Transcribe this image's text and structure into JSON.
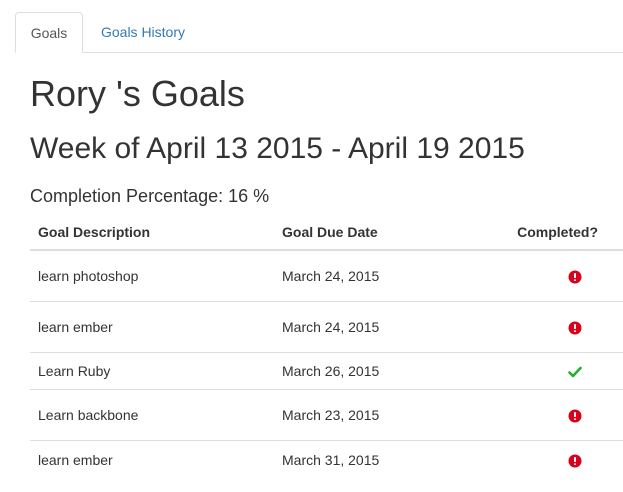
{
  "tabs": [
    {
      "label": "Goals",
      "active": true
    },
    {
      "label": "Goals History",
      "active": false
    }
  ],
  "title": "Rory 's Goals",
  "week": "Week of April 13 2015 - April 19 2015",
  "completion": "Completion Percentage: 16 %",
  "table": {
    "headers": [
      "Goal Description",
      "Goal Due Date",
      "Completed?"
    ],
    "rows": [
      {
        "description": "learn photoshop",
        "due_date": "March 24, 2015",
        "status_icon": "exclamation-circle-icon",
        "completed": false
      },
      {
        "description": "learn ember",
        "due_date": "March 24, 2015",
        "status_icon": "exclamation-circle-icon",
        "completed": false
      },
      {
        "description": "Learn Ruby",
        "due_date": "March 26, 2015",
        "status_icon": "checkmark-icon",
        "completed": true
      },
      {
        "description": "Learn backbone",
        "due_date": "March 23, 2015",
        "status_icon": "exclamation-circle-icon",
        "completed": false
      },
      {
        "description": "learn ember",
        "due_date": "March 31, 2015",
        "status_icon": "exclamation-circle-icon",
        "completed": false
      }
    ]
  },
  "colors": {
    "link": "#337ab7",
    "incomplete": "#d9001b",
    "complete": "#1db32e",
    "text": "#333333",
    "border": "#dddddd"
  }
}
